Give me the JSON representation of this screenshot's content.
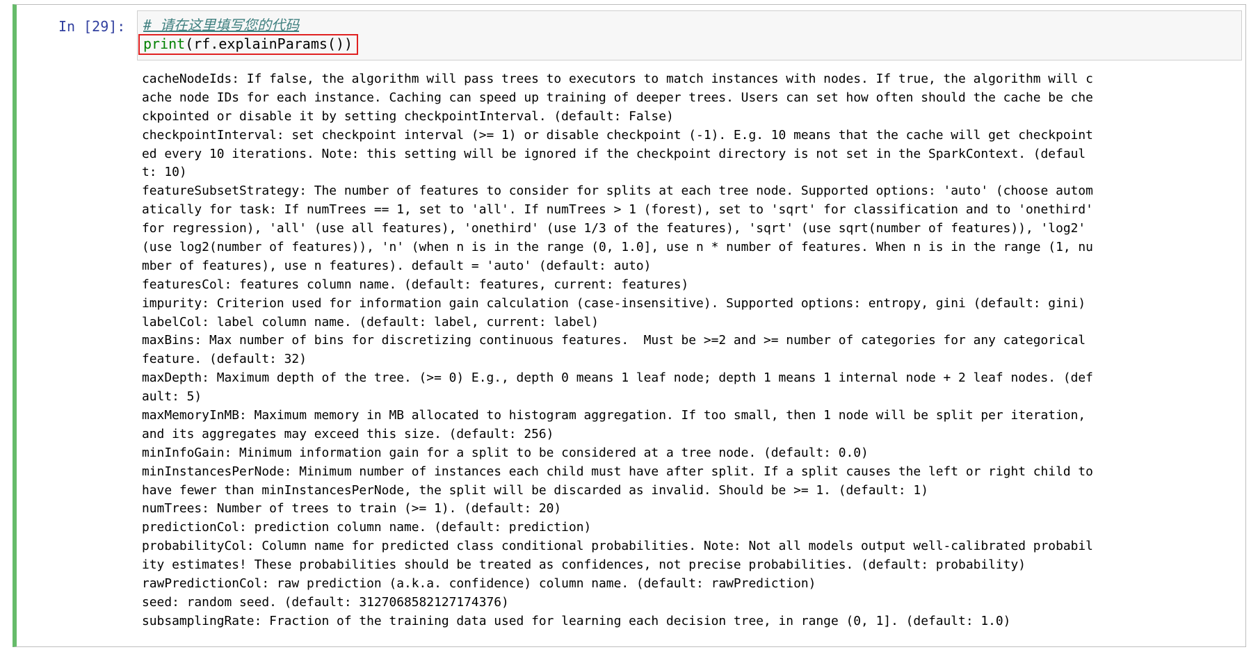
{
  "cell": {
    "prompt": "In [29]:",
    "code": {
      "comment": "# 请在这里填写您的代码",
      "builtin": "print",
      "open_paren": "(",
      "expr": "rf.explainParams()",
      "close_paren": ")"
    },
    "output_lines": [
      "cacheNodeIds: If false, the algorithm will pass trees to executors to match instances with nodes. If true, the algorithm will c",
      "ache node IDs for each instance. Caching can speed up training of deeper trees. Users can set how often should the cache be che",
      "ckpointed or disable it by setting checkpointInterval. (default: False)",
      "checkpointInterval: set checkpoint interval (>= 1) or disable checkpoint (-1). E.g. 10 means that the cache will get checkpoint",
      "ed every 10 iterations. Note: this setting will be ignored if the checkpoint directory is not set in the SparkContext. (defaul",
      "t: 10)",
      "featureSubsetStrategy: The number of features to consider for splits at each tree node. Supported options: 'auto' (choose autom",
      "atically for task: If numTrees == 1, set to 'all'. If numTrees > 1 (forest), set to 'sqrt' for classification and to 'onethird'",
      "for regression), 'all' (use all features), 'onethird' (use 1/3 of the features), 'sqrt' (use sqrt(number of features)), 'log2'",
      "(use log2(number of features)), 'n' (when n is in the range (0, 1.0], use n * number of features. When n is in the range (1, nu",
      "mber of features), use n features). default = 'auto' (default: auto)",
      "featuresCol: features column name. (default: features, current: features)",
      "impurity: Criterion used for information gain calculation (case-insensitive). Supported options: entropy, gini (default: gini)",
      "labelCol: label column name. (default: label, current: label)",
      "maxBins: Max number of bins for discretizing continuous features.  Must be >=2 and >= number of categories for any categorical",
      "feature. (default: 32)",
      "maxDepth: Maximum depth of the tree. (>= 0) E.g., depth 0 means 1 leaf node; depth 1 means 1 internal node + 2 leaf nodes. (def",
      "ault: 5)",
      "maxMemoryInMB: Maximum memory in MB allocated to histogram aggregation. If too small, then 1 node will be split per iteration,",
      "and its aggregates may exceed this size. (default: 256)",
      "minInfoGain: Minimum information gain for a split to be considered at a tree node. (default: 0.0)",
      "minInstancesPerNode: Minimum number of instances each child must have after split. If a split causes the left or right child to",
      "have fewer than minInstancesPerNode, the split will be discarded as invalid. Should be >= 1. (default: 1)",
      "numTrees: Number of trees to train (>= 1). (default: 20)",
      "predictionCol: prediction column name. (default: prediction)",
      "probabilityCol: Column name for predicted class conditional probabilities. Note: Not all models output well-calibrated probabil",
      "ity estimates! These probabilities should be treated as confidences, not precise probabilities. (default: probability)",
      "rawPredictionCol: raw prediction (a.k.a. confidence) column name. (default: rawPrediction)",
      "seed: random seed. (default: 3127068582127174376)",
      "subsamplingRate: Fraction of the training data used for learning each decision tree, in range (0, 1]. (default: 1.0)"
    ],
    "colors": {
      "selected_border": "#66bb6a",
      "prompt": "#303f9f",
      "comment": "#408080",
      "builtin": "#008000",
      "highlight_box": "#e02020"
    }
  }
}
